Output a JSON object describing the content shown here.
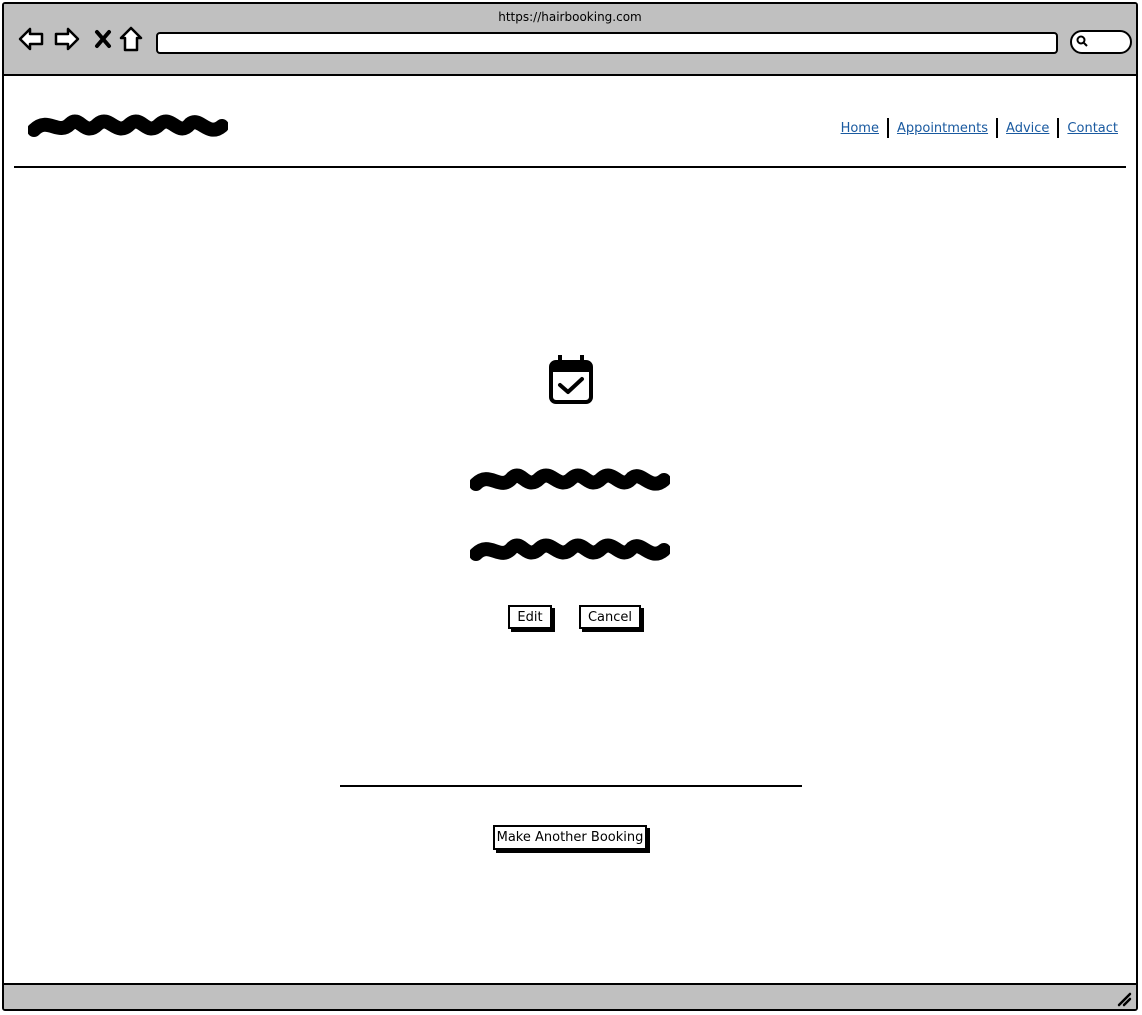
{
  "browser": {
    "url": "https://hairbooking.com"
  },
  "nav": {
    "items": [
      "Home",
      "Appointments",
      "Advice",
      "Contact"
    ]
  },
  "confirmation": {
    "icon": "calendar-check-icon",
    "edit_label": "Edit",
    "cancel_label": "Cancel"
  },
  "footer": {
    "another_booking_label": "Make Another Booking"
  },
  "colors": {
    "link": "#1a5aa0",
    "chrome": "#c0c0c0"
  }
}
